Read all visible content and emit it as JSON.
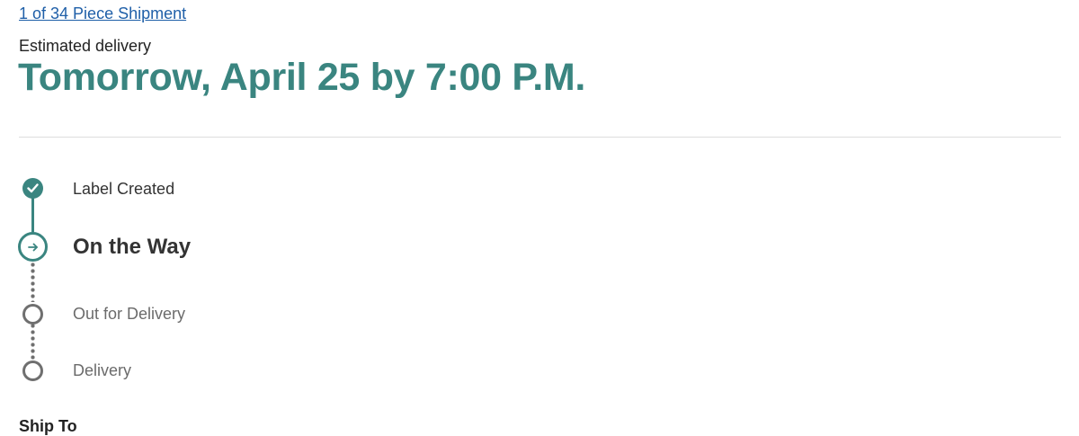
{
  "shipment": {
    "link_text": "1 of 34 Piece Shipment"
  },
  "estimate": {
    "label": "Estimated delivery",
    "date": "Tomorrow, April 25 by 7:00 P.M."
  },
  "timeline": {
    "steps": [
      {
        "label": "Label Created",
        "state": "done",
        "icon": "check-icon"
      },
      {
        "label": "On the Way",
        "state": "current",
        "icon": "arrow-right-icon"
      },
      {
        "label": "Out for Delivery",
        "state": "pending",
        "icon": "empty-circle-icon"
      },
      {
        "label": "Delivery",
        "state": "pending",
        "icon": "empty-circle-icon"
      }
    ]
  },
  "ship_to": {
    "heading": "Ship To"
  },
  "colors": {
    "accent": "#3a8580",
    "link": "#1f5fa8",
    "pending": "#6f6f6f"
  }
}
